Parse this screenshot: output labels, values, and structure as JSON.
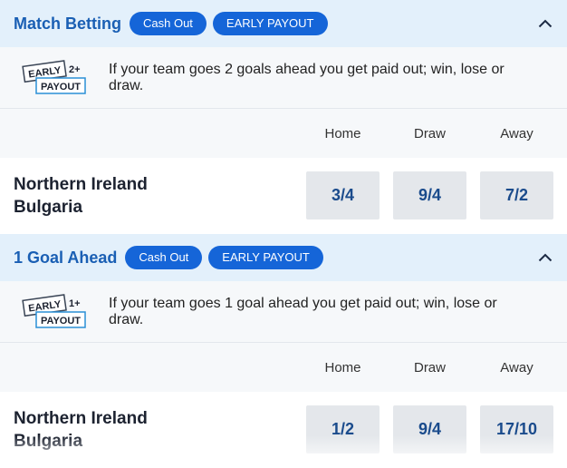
{
  "markets": [
    {
      "title": "Match Betting",
      "pills": [
        "Cash Out",
        "EARLY PAYOUT"
      ],
      "badge": {
        "line1": "EARLY",
        "number": "2+",
        "line2": "PAYOUT"
      },
      "info_text": "If your team goes 2 goals ahead you get paid out; win, lose or draw.",
      "columns": [
        "Home",
        "Draw",
        "Away"
      ],
      "event": {
        "home": "Northern Ireland",
        "away": "Bulgaria"
      },
      "odds": [
        "3/4",
        "9/4",
        "7/2"
      ]
    },
    {
      "title": "1 Goal Ahead",
      "pills": [
        "Cash Out",
        "EARLY PAYOUT"
      ],
      "badge": {
        "line1": "EARLY",
        "number": "1+",
        "line2": "PAYOUT"
      },
      "info_text": "If your team goes 1 goal ahead you get paid out; win, lose or draw.",
      "columns": [
        "Home",
        "Draw",
        "Away"
      ],
      "event": {
        "home": "Northern Ireland",
        "away": "Bulgaria"
      },
      "odds": [
        "1/2",
        "9/4",
        "17/10"
      ]
    }
  ],
  "icons": {
    "collapse": "chevron-up-icon",
    "badge": "early-payout-badge-icon"
  },
  "colors": {
    "accent": "#1565d8",
    "title": "#1a5fb4",
    "header_bg": "#e3f0fb",
    "odds_bg": "#e4e7eb"
  }
}
